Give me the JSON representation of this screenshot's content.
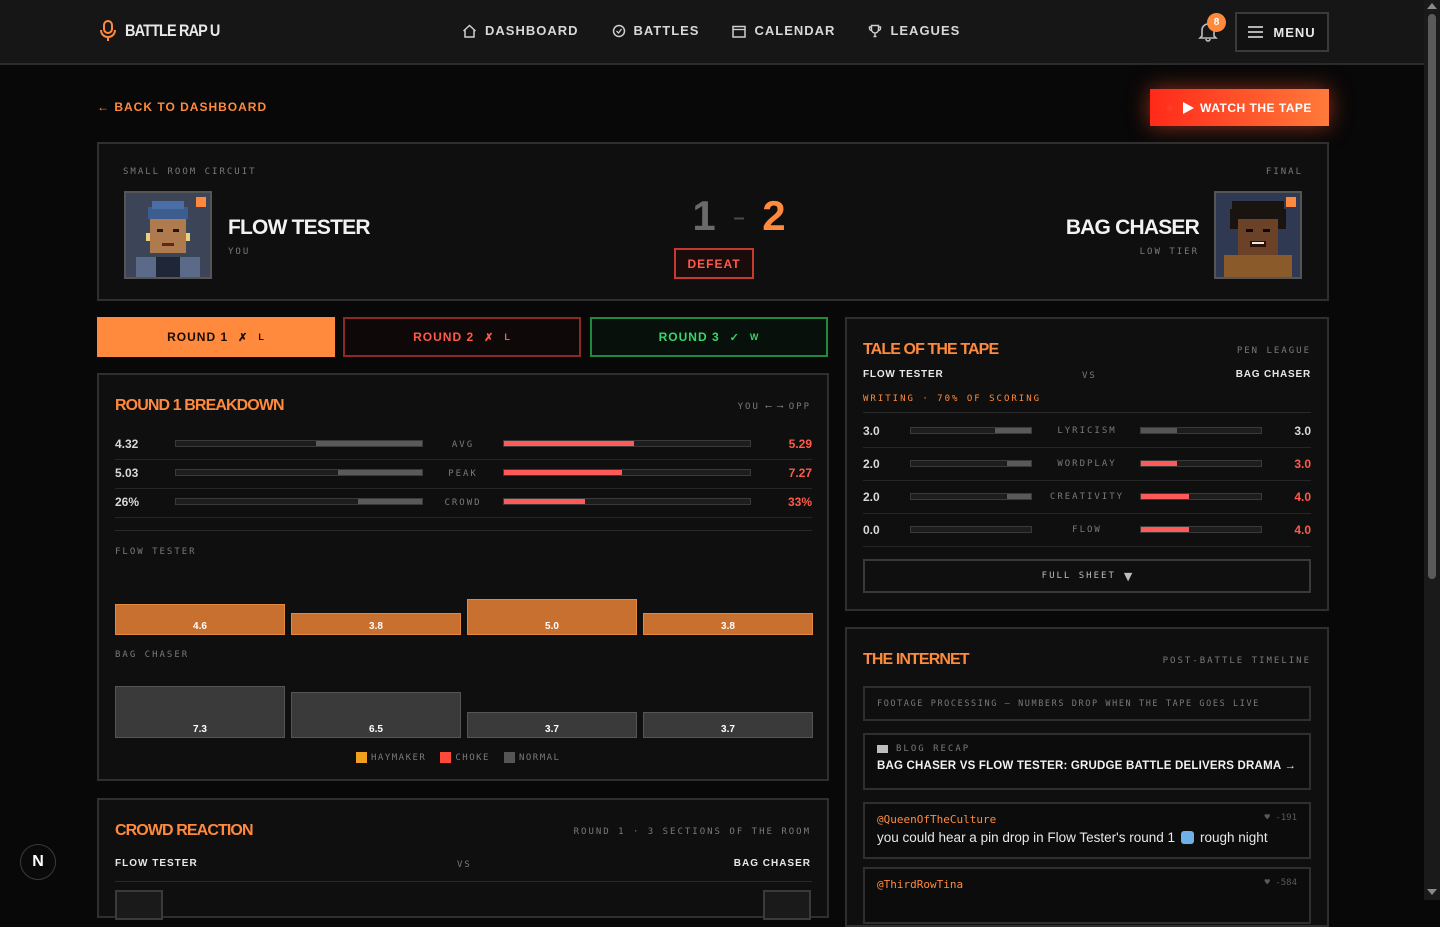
{
  "nav": {
    "logo": "BATTLE RAP U",
    "links": [
      "DASHBOARD",
      "BATTLES",
      "CALENDAR",
      "LEAGUES"
    ],
    "notifications": "8",
    "menu": "MENU"
  },
  "header": {
    "back": "← BACK TO DASHBOARD",
    "watch": "WATCH THE TAPE"
  },
  "matchup": {
    "circuit": "SMALL ROOM CIRCUIT",
    "status": "FINAL",
    "left": {
      "name": "FLOW TESTER",
      "sub": "YOU"
    },
    "right": {
      "name": "BAG CHASER",
      "sub": "LOW TIER"
    },
    "score_left": "1",
    "score_sep": "–",
    "score_right": "2",
    "result": "DEFEAT"
  },
  "rounds": [
    {
      "label": "ROUND 1",
      "mark": "✗",
      "res": "L"
    },
    {
      "label": "ROUND 2",
      "mark": "✗",
      "res": "L"
    },
    {
      "label": "ROUND 3",
      "mark": "✓",
      "res": "W"
    }
  ],
  "breakdown": {
    "title": "ROUND 1 BREAKDOWN",
    "you_label": "YOU",
    "opp_label": "OPP",
    "rows": [
      {
        "label": "AVG",
        "you": "4.32",
        "opp": "5.29",
        "you_frac": 0.43,
        "opp_frac": 0.53
      },
      {
        "label": "PEAK",
        "you": "5.03",
        "opp": "7.27",
        "you_frac": 0.34,
        "opp_frac": 0.48
      },
      {
        "label": "CROWD",
        "you": "26%",
        "opp": "33%",
        "you_frac": 0.26,
        "opp_frac": 0.33
      }
    ],
    "you_name": "FLOW TESTER",
    "opp_name": "BAG CHASER",
    "you_bars": [
      {
        "value": "4.6",
        "v": 4.6,
        "type": "haymaker"
      },
      {
        "value": "3.8",
        "v": 3.8,
        "type": "haymaker"
      },
      {
        "value": "5.0",
        "v": 5.0,
        "type": "haymaker"
      },
      {
        "value": "3.8",
        "v": 3.8,
        "type": "haymaker"
      }
    ],
    "opp_bars": [
      {
        "value": "7.3",
        "v": 7.3,
        "type": "normal"
      },
      {
        "value": "6.5",
        "v": 6.5,
        "type": "normal"
      },
      {
        "value": "3.7",
        "v": 3.7,
        "type": "normal"
      },
      {
        "value": "3.7",
        "v": 3.7,
        "type": "normal"
      }
    ],
    "legend": [
      "HAYMAKER",
      "CHOKE",
      "NORMAL"
    ]
  },
  "crowd": {
    "title": "CROWD REACTION",
    "meta": "ROUND 1 · 3 SECTIONS OF THE ROOM",
    "left": "FLOW TESTER",
    "vs": "VS",
    "right": "BAG CHASER"
  },
  "tape": {
    "title": "TALE OF THE TAPE",
    "league": "PEN LEAGUE",
    "left": "FLOW TESTER",
    "vs": "VS",
    "right": "BAG CHASER",
    "section": "WRITING · 70% OF SCORING",
    "rows": [
      {
        "label": "LYRICISM",
        "you": "3.0",
        "opp": "3.0",
        "you_frac": 0.3,
        "opp_frac": 0.3,
        "opp_color": "#555555"
      },
      {
        "label": "WORDPLAY",
        "you": "2.0",
        "opp": "3.0",
        "you_frac": 0.2,
        "opp_frac": 0.3,
        "opp_color": "#ff5a5a"
      },
      {
        "label": "CREATIVITY",
        "you": "2.0",
        "opp": "4.0",
        "you_frac": 0.2,
        "opp_frac": 0.4,
        "opp_color": "#ff5a5a"
      },
      {
        "label": "FLOW",
        "you": "0.0",
        "opp": "4.0",
        "you_frac": 0.0,
        "opp_frac": 0.4,
        "opp_color": "#ff5a5a"
      }
    ],
    "full_sheet": "FULL SHEET"
  },
  "internet": {
    "title": "THE INTERNET",
    "meta": "POST-BATTLE TIMELINE",
    "notice": "FOOTAGE PROCESSING — NUMBERS DROP WHEN THE TAPE GOES LIVE",
    "blog_tag": "BLOG RECAP",
    "blog_title": "BAG CHASER VS FLOW TESTER: GRUDGE BATTLE DELIVERS DRAMA →",
    "posts": [
      {
        "handle": "@QueenOfTheCulture",
        "likes": "♥ -191",
        "text": "you could hear a pin drop in Flow Tester's round 1",
        "tail": "rough night"
      },
      {
        "handle": "@ThirdRowTina",
        "likes": "♥ -584",
        "text": "",
        "tail": ""
      }
    ]
  },
  "colors": {
    "accent": "#ff8a3d",
    "loss": "#c43a2f",
    "win": "#2ecc5a",
    "opp_bar": "#ff5a5a",
    "haymaker": "#d0702f",
    "choke": "#ff4a3a",
    "normal": "#3a3a3a"
  }
}
